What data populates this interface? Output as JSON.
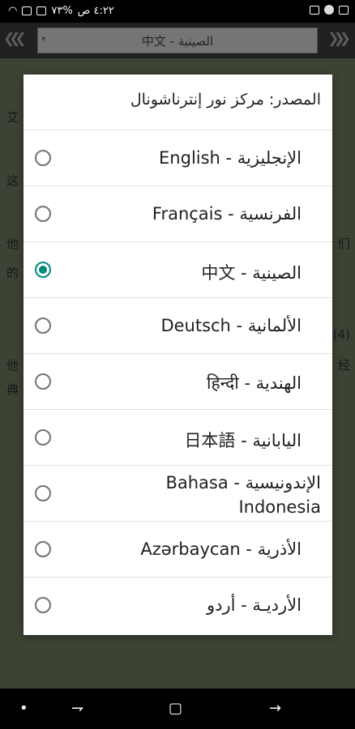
{
  "status_bar": {
    "time": "٤:٢٢ ص",
    "battery": "%٧٣"
  },
  "toolbar": {
    "prev_arrows": "❮❮❮",
    "next_arrows": "❯❯❯",
    "language_select": "中文 - الصينية"
  },
  "background": {
    "lines": [
      "艾",
      "这",
      "他",
      "的",
      "他",
      "典",
      "们",
      "(4)",
      "经"
    ]
  },
  "dialog": {
    "title": "المصدر: مركز نور إنترناشونال",
    "options": [
      {
        "label": "English - الإنجليزية",
        "checked": false
      },
      {
        "label": "Français - الفرنسية",
        "checked": false
      },
      {
        "label": "中文 - الصينية",
        "checked": true
      },
      {
        "label": "Deutsch - الألمانية",
        "checked": false
      },
      {
        "label": "हिन्दी - الهندية",
        "checked": false
      },
      {
        "label": "日本語 - اليابانية",
        "checked": false
      },
      {
        "label": "Bahasa - الإندونيسية Indonesia",
        "checked": false
      },
      {
        "label": "Azərbaycan - الأذرية",
        "checked": false
      },
      {
        "label": "الأرديـة - أردو",
        "checked": false
      }
    ]
  },
  "nav_bar": {
    "dot": "•",
    "back": "⇁",
    "recents": "▢",
    "forward": "→"
  },
  "colors": {
    "accent": "#00897b",
    "toolbar": "#3b3b3b",
    "app_background": "#6e7a60"
  }
}
